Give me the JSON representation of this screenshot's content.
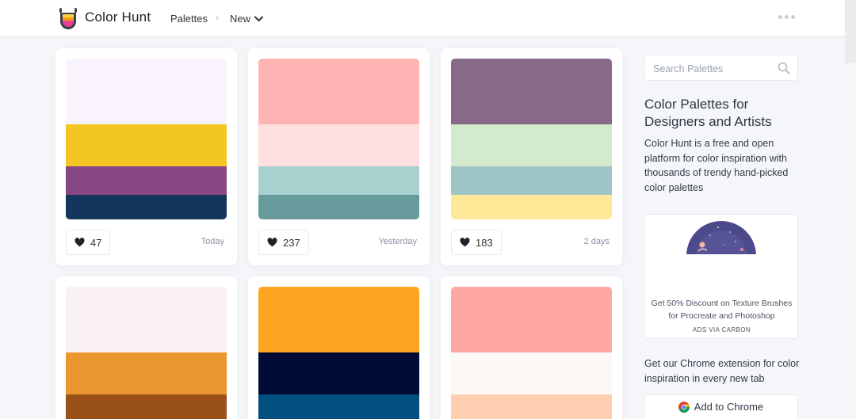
{
  "header": {
    "brand": "Color Hunt",
    "breadcrumb": {
      "palettes": "Palettes",
      "separator": "›",
      "current": "New"
    }
  },
  "palettes": [
    {
      "colors": [
        "#f8f3fc",
        "#f3c623",
        "#874784",
        "#12365c"
      ],
      "likes": "47",
      "date": "Today"
    },
    {
      "colors": [
        "#ffb4b4",
        "#ffdfe0",
        "#a8d0ce",
        "#679b9b"
      ],
      "likes": "237",
      "date": "Yesterday"
    },
    {
      "colors": [
        "#866a88",
        "#d4eacc",
        "#a0c5c7",
        "#fee998"
      ],
      "likes": "183",
      "date": "2 days"
    },
    {
      "colors": [
        "#faf2f2",
        "#ec9630",
        "#9a5118"
      ],
      "likes": "",
      "date": ""
    },
    {
      "colors": [
        "#fda521",
        "#000b36",
        "#024f7f"
      ],
      "likes": "",
      "date": ""
    },
    {
      "colors": [
        "#ffa8a3",
        "#fcf8f5",
        "#ffcdb0"
      ],
      "likes": "",
      "date": ""
    }
  ],
  "sidebar": {
    "search_placeholder": "Search Palettes",
    "title": "Color Palettes for Designers and Artists",
    "description": "Color Hunt is a free and open platform for color inspiration with thousands of trendy hand-picked color palettes",
    "ad": {
      "text": "Get 50% Discount on Texture Brushes for Procreate and Photoshop",
      "via": "ADS VIA CARBON"
    },
    "extension_text": "Get our Chrome extension for color inspiration in every new tab",
    "add_to_chrome": "Add to Chrome"
  },
  "icons": {
    "logo": "color-hunt-logo",
    "heart": "heart-icon",
    "search": "search-icon",
    "chevron": "chevron-down-icon",
    "more": "more-dots-icon",
    "chrome": "chrome-icon"
  }
}
